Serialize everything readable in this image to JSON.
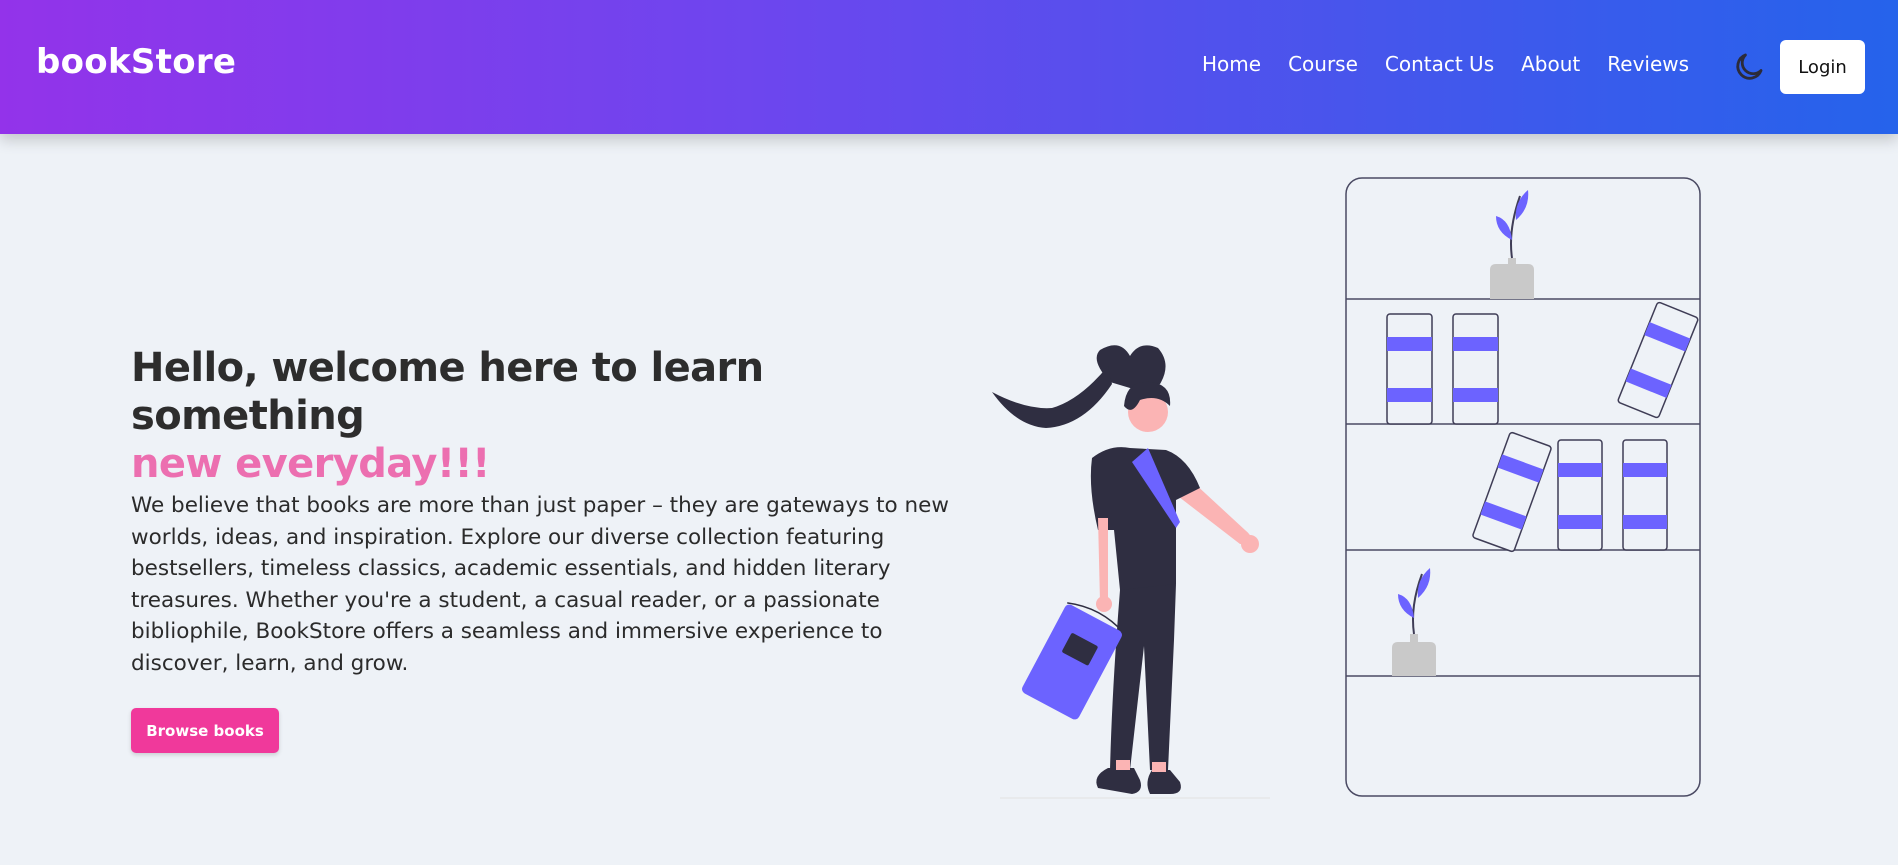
{
  "navbar": {
    "brand": "bookStore",
    "links": [
      "Home",
      "Course",
      "Contact Us",
      "About",
      "Reviews"
    ],
    "theme_toggle_icon": "moon-icon",
    "login_label": "Login",
    "gradient_start": "#9333ea",
    "gradient_end": "#2563eb"
  },
  "hero": {
    "title_line1": "Hello, welcome here to learn something",
    "title_line2": "new everyday!!!",
    "description": "We believe that books are more than just paper – they are gateways to new worlds, ideas, and inspiration. Explore our diverse collection featuring bestsellers, timeless classics, academic essentials, and hidden literary treasures. Whether you're a student, a casual reader, or a passionate bibliophile, BookStore offers a seamless and immersive experience to discover, learn, and grow.",
    "button_label": "Browse books",
    "accent_color": "#ec6fb0",
    "button_color": "#f0399b"
  },
  "illustration": {
    "icon": "woman-reading-bookshelf-illustration",
    "accent_color": "#6c63ff"
  }
}
